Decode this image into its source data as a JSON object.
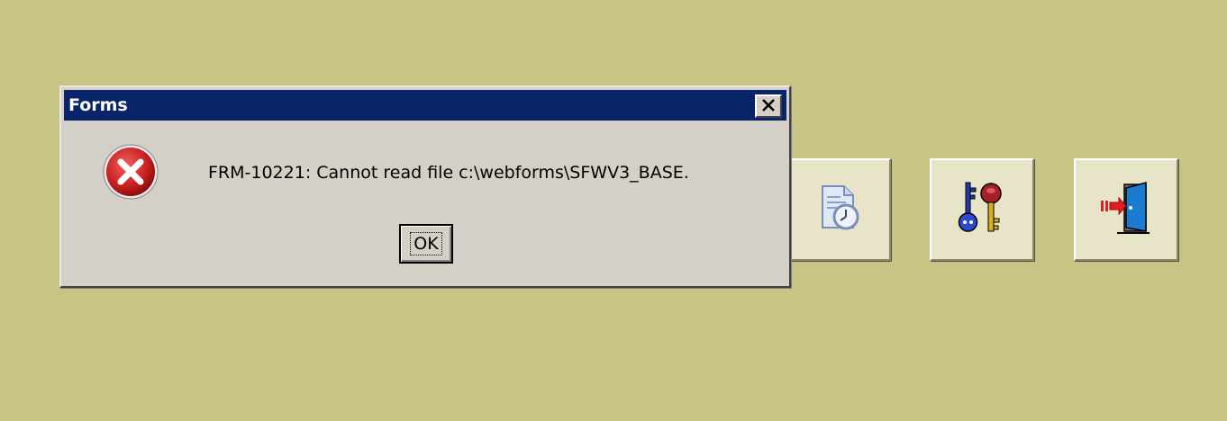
{
  "toolbar": {
    "buttons": [
      {
        "icon": "report-clock-icon"
      },
      {
        "icon": "keys-icon"
      },
      {
        "icon": "exit-door-icon"
      }
    ]
  },
  "dialog": {
    "title": "Forms",
    "icon": "error-icon",
    "message": "FRM-10221: Cannot read file c:\\webforms\\SFWV3_BASE.",
    "ok_label": "OK",
    "close_icon": "close-icon"
  },
  "colors": {
    "desktop": "#c7c485",
    "titlebar": "#0a246a",
    "dialog": "#d4d0c8",
    "error_red": "#c81e1e"
  }
}
